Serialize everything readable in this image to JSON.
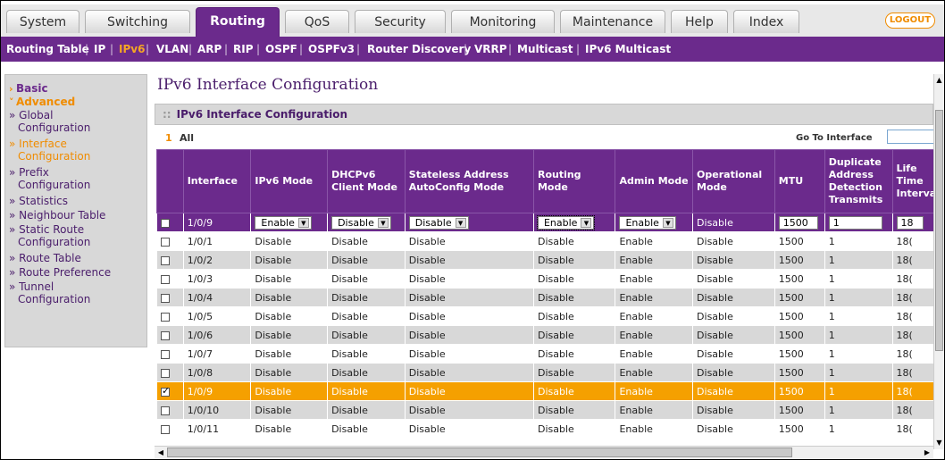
{
  "tabs": [
    "System",
    "Switching",
    "Routing",
    "QoS",
    "Security",
    "Monitoring",
    "Maintenance",
    "Help",
    "Index"
  ],
  "active_tab": "Routing",
  "logout_label": "LOGOUT",
  "subnav": [
    "Routing Table",
    "IP",
    "IPv6",
    "VLAN",
    "ARP",
    "RIP",
    "OSPF",
    "OSPFv3",
    "Router Discovery",
    "VRRP",
    "Multicast",
    "IPv6 Multicast"
  ],
  "active_subnav": "IPv6",
  "sidebar": {
    "basic": "Basic",
    "advanced": "Advanced",
    "items": [
      [
        "Global",
        "Configuration"
      ],
      [
        "Interface",
        "Configuration"
      ],
      [
        "Prefix",
        "Configuration"
      ],
      [
        "Statistics"
      ],
      [
        "Neighbour Table"
      ],
      [
        "Static Route",
        "Configuration"
      ],
      [
        "Route Table"
      ],
      [
        "Route Preference"
      ],
      [
        "Tunnel",
        "Configuration"
      ]
    ]
  },
  "page_title": "IPv6 Interface Configuration",
  "panel_title": "IPv6 Interface Configuration",
  "all_count": "1",
  "all_label": "All",
  "goto_label": "Go To Interface",
  "table": {
    "headers": [
      "",
      "Interface",
      "IPv6 Mode",
      "DHCPv6 Client Mode",
      "Stateless Address AutoConfig Mode",
      "Routing Mode",
      "Admin Mode",
      "Operational Mode",
      "MTU",
      "Duplicate Address Detection Transmits",
      "Life Time Interval"
    ],
    "edit_row": [
      "1/0/9",
      "Enable",
      "Disable",
      "Disable",
      "Enable",
      "Enable",
      "Disable",
      "1500",
      "1",
      "18"
    ],
    "rows": [
      [
        "1/0/1",
        "Disable",
        "Disable",
        "Disable",
        "Disable",
        "Enable",
        "Disable",
        "1500",
        "1",
        "18("
      ],
      [
        "1/0/2",
        "Disable",
        "Disable",
        "Disable",
        "Disable",
        "Enable",
        "Disable",
        "1500",
        "1",
        "18("
      ],
      [
        "1/0/3",
        "Disable",
        "Disable",
        "Disable",
        "Disable",
        "Enable",
        "Disable",
        "1500",
        "1",
        "18("
      ],
      [
        "1/0/4",
        "Disable",
        "Disable",
        "Disable",
        "Disable",
        "Enable",
        "Disable",
        "1500",
        "1",
        "18("
      ],
      [
        "1/0/5",
        "Disable",
        "Disable",
        "Disable",
        "Disable",
        "Enable",
        "Disable",
        "1500",
        "1",
        "18("
      ],
      [
        "1/0/6",
        "Disable",
        "Disable",
        "Disable",
        "Disable",
        "Enable",
        "Disable",
        "1500",
        "1",
        "18("
      ],
      [
        "1/0/7",
        "Disable",
        "Disable",
        "Disable",
        "Disable",
        "Enable",
        "Disable",
        "1500",
        "1",
        "18("
      ],
      [
        "1/0/8",
        "Disable",
        "Disable",
        "Disable",
        "Disable",
        "Enable",
        "Disable",
        "1500",
        "1",
        "18("
      ],
      [
        "1/0/9",
        "Disable",
        "Disable",
        "Disable",
        "Disable",
        "Enable",
        "Disable",
        "1500",
        "1",
        "18("
      ],
      [
        "1/0/10",
        "Disable",
        "Disable",
        "Disable",
        "Disable",
        "Enable",
        "Disable",
        "1500",
        "1",
        "18("
      ],
      [
        "1/0/11",
        "Disable",
        "Disable",
        "Disable",
        "Disable",
        "Enable",
        "Disable",
        "1500",
        "1",
        "18("
      ]
    ],
    "selected_row_index": 8
  },
  "colors": {
    "purple": "#6b2a8c",
    "orange": "#f5a000",
    "gray": "#d8d8d8"
  }
}
